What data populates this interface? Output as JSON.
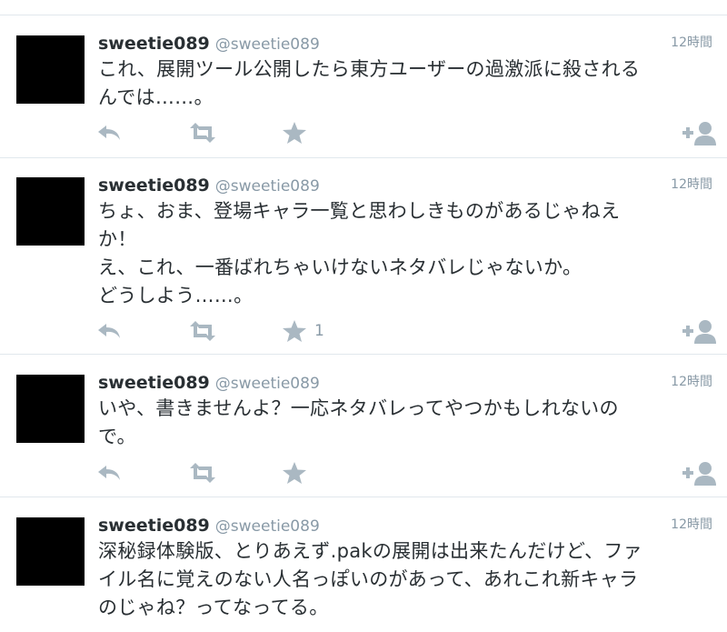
{
  "colors": {
    "text": "#292f33",
    "muted": "#8899a6",
    "icon": "#aab8c2",
    "divider": "#e1e8ed",
    "avatar": "#000000"
  },
  "tweets": [
    {
      "name": "sweetie089",
      "handle": "@sweetie089",
      "time": "12時間",
      "text": "これ、展開ツール公開したら東方ユーザーの過激派に殺される\nんでは……。",
      "favorites": ""
    },
    {
      "name": "sweetie089",
      "handle": "@sweetie089",
      "time": "12時間",
      "text": "ちょ、おま、登場キャラ一覧と思わしきものがあるじゃねえ\nか！\nえ、これ、一番ばれちゃいけないネタバレじゃないか。\nどうしよう……。",
      "favorites": "1"
    },
    {
      "name": "sweetie089",
      "handle": "@sweetie089",
      "time": "12時間",
      "text": "いや、書きませんよ？一応ネタバレってやつかもしれないの\nで。",
      "favorites": ""
    },
    {
      "name": "sweetie089",
      "handle": "@sweetie089",
      "time": "12時間",
      "text": "深秘録体験版、とりあえず.pakの展開は出来たんだけど、ファ\nイル名に覚えのない人名っぽいのがあって、あれこれ新キャラ\nのじゃね？ってなってる。",
      "favorites": ""
    }
  ],
  "icons": {
    "reply": "reply-icon",
    "retweet": "retweet-icon",
    "favorite": "star-icon",
    "follow": "follow-icon"
  }
}
